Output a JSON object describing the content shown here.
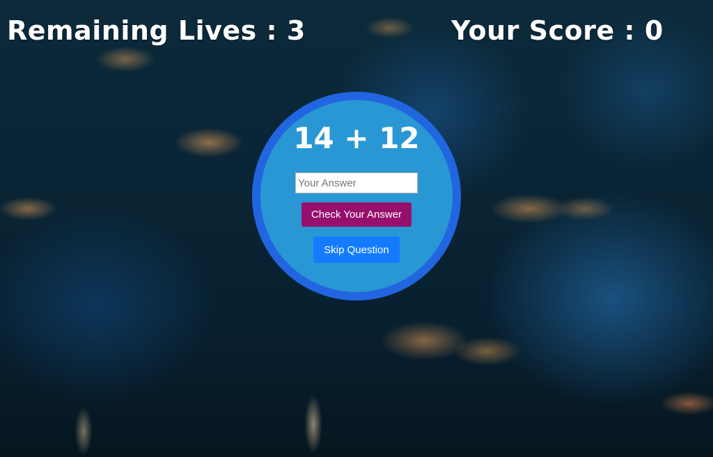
{
  "hud": {
    "lives_text": "Remaining Lives : 3",
    "score_text": "Your Score : 0"
  },
  "quiz": {
    "question": "14 + 12",
    "answer_placeholder": "Your Answer",
    "answer_value": "",
    "check_label": "Check Your Answer",
    "skip_label": "Skip Question"
  },
  "colors": {
    "circle_fill": "#2997d3",
    "circle_border": "#2166e0",
    "check_button": "#970f6c",
    "skip_button": "#147bff",
    "text": "#ffffff"
  }
}
